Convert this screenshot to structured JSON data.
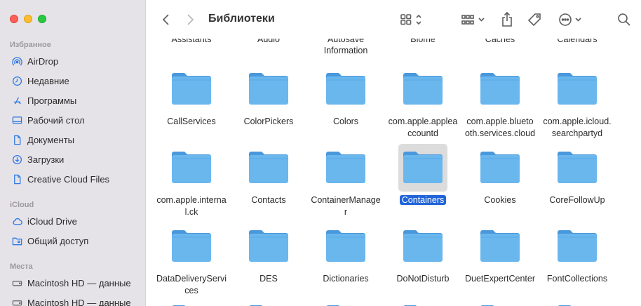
{
  "window": {
    "title": "Библиотеки"
  },
  "sidebar": {
    "sections": [
      {
        "title": "Избранное",
        "items": [
          {
            "label": "AirDrop",
            "icon": "airdrop-icon"
          },
          {
            "label": "Недавние",
            "icon": "clock-icon"
          },
          {
            "label": "Программы",
            "icon": "apps-icon"
          },
          {
            "label": "Рабочий стол",
            "icon": "desktop-icon"
          },
          {
            "label": "Документы",
            "icon": "document-icon"
          },
          {
            "label": "Загрузки",
            "icon": "download-icon"
          },
          {
            "label": "Creative Cloud Files",
            "icon": "file-icon"
          }
        ]
      },
      {
        "title": "iCloud",
        "items": [
          {
            "label": "iCloud Drive",
            "icon": "cloud-icon"
          },
          {
            "label": "Общий доступ",
            "icon": "shared-folder-icon"
          }
        ]
      },
      {
        "title": "Места",
        "items": [
          {
            "label": "Macintosh HD — данные",
            "icon": "disk-icon"
          },
          {
            "label": "Macintosh HD — данные",
            "icon": "disk-icon"
          }
        ]
      }
    ]
  },
  "toolbar": {
    "back_icon": "chevron-left-icon",
    "forward_icon": "chevron-right-icon",
    "view_icon": "grid-view-icon",
    "group_icon": "group-icon",
    "share_icon": "share-icon",
    "tag_icon": "tag-icon",
    "more_icon": "more-icon",
    "search_icon": "search-icon"
  },
  "content": {
    "top_row": [
      {
        "label": "Assistants"
      },
      {
        "label": "Audio"
      },
      {
        "label": "Autosave\nInformation"
      },
      {
        "label": "Biome"
      },
      {
        "label": "Caches"
      },
      {
        "label": "Calendars"
      }
    ],
    "rows": [
      [
        {
          "label": "CallServices"
        },
        {
          "label": "ColorPickers"
        },
        {
          "label": "Colors"
        },
        {
          "label": "com.apple.applea\nccountd"
        },
        {
          "label": "com.apple.blueto\noth.services.cloud"
        },
        {
          "label": "com.apple.icloud.\nsearchpartyd"
        }
      ],
      [
        {
          "label": "com.apple.interna\nl.ck"
        },
        {
          "label": "Contacts"
        },
        {
          "label": "ContainerManage\nr"
        },
        {
          "label": "Containers",
          "selected": true
        },
        {
          "label": "Cookies"
        },
        {
          "label": "CoreFollowUp"
        }
      ],
      [
        {
          "label": "DataDeliveryServi\nces"
        },
        {
          "label": "DES"
        },
        {
          "label": "Dictionaries"
        },
        {
          "label": "DoNotDisturb"
        },
        {
          "label": "DuetExpertCenter"
        },
        {
          "label": "FontCollections"
        }
      ]
    ],
    "folder_color": "#6ab7ee",
    "selection_color": "#2164d9"
  }
}
